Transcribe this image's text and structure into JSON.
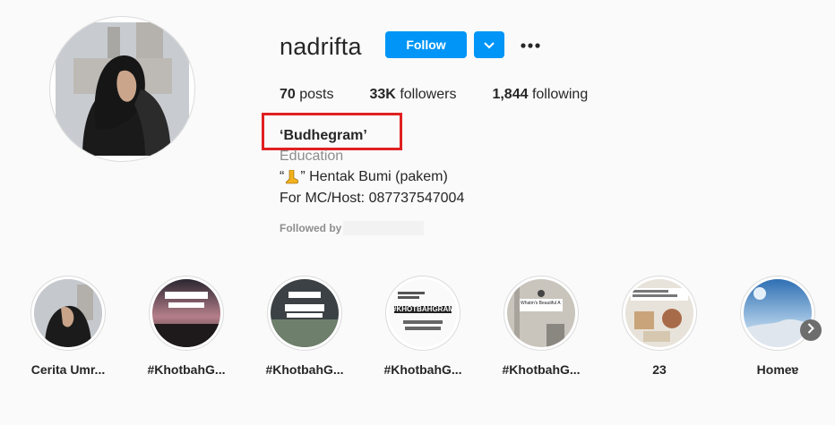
{
  "profile": {
    "username": "nadrifta",
    "follow_label": "Follow",
    "stats": {
      "posts_count": "70",
      "posts_label": "posts",
      "followers_count": "33K",
      "followers_label": "followers",
      "following_count": "1,844",
      "following_label": "following"
    },
    "full_name": "‘Budhegram’",
    "category": "Education",
    "bio_line1_prefix": "“",
    "bio_line1_suffix": "” Hentak Bumi (pakem)",
    "bio_line2": "For MC/Host: 087737547004",
    "followed_by_label": "Followed by"
  },
  "icons": {
    "dropdown": "chevron-down-icon",
    "more": "more-options-icon",
    "boot_emoji": "boot-icon",
    "next": "chevron-right-icon"
  },
  "colors": {
    "primary_button": "#0095f6",
    "annotation_box": "#e02020",
    "secondary_text": "#8e8e8e"
  },
  "highlights": [
    {
      "label": "Cerita Umr..."
    },
    {
      "label": "#KhotbahG..."
    },
    {
      "label": "#KhotbahG..."
    },
    {
      "label": "#KhotbahG..."
    },
    {
      "label": "#KhotbahG..."
    },
    {
      "label": "23"
    },
    {
      "label": "Homeɐ"
    }
  ],
  "highlight_texts": {
    "h4_title": "#KHOTBAHGRAM",
    "h5_caption": "Whatm's Beautiful A THA"
  }
}
